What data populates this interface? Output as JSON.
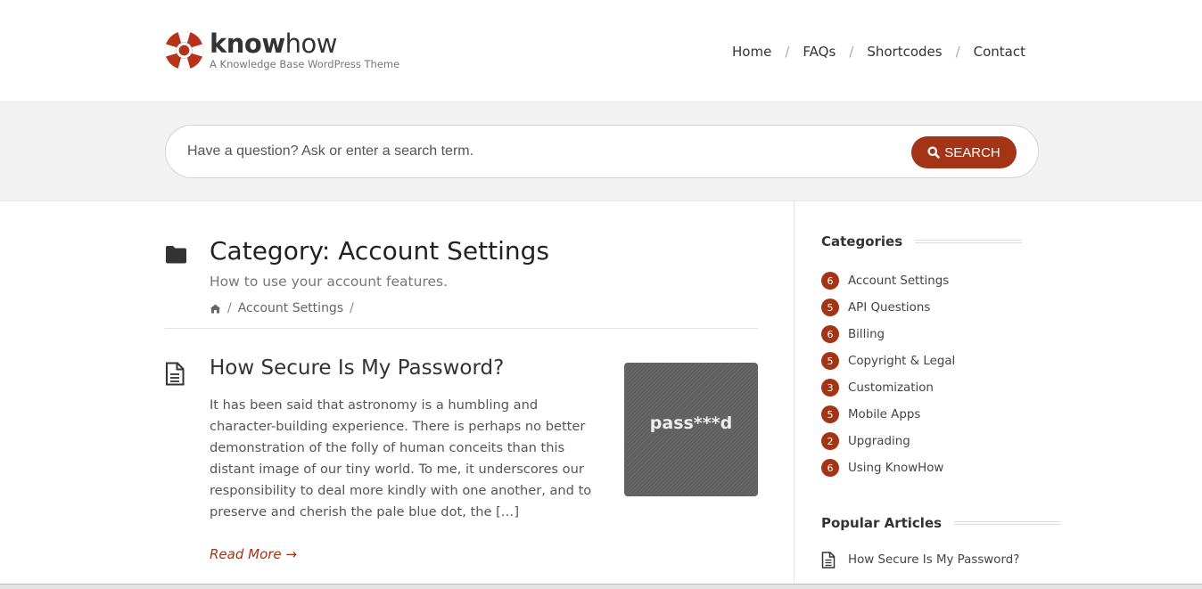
{
  "brand": {
    "name_bold": "know",
    "name_regular": "how",
    "tagline": "A Knowledge Base WordPress Theme",
    "logo_icon": "lifebuoy-icon",
    "accent_color": "#a33416"
  },
  "nav": {
    "items": [
      {
        "label": "Home"
      },
      {
        "label": "FAQs"
      },
      {
        "label": "Shortcodes"
      },
      {
        "label": "Contact"
      }
    ],
    "separator": "/"
  },
  "search": {
    "placeholder": "Have a question? Ask or enter a search term.",
    "button_label": "SEARCH",
    "button_icon": "search-icon"
  },
  "category": {
    "icon": "folder-icon",
    "title": "Category: Account Settings",
    "description": "How to use your account features.",
    "breadcrumb": {
      "home_icon": "home-icon",
      "current": "Account Settings",
      "separator": "/"
    }
  },
  "article": {
    "icon": "document-icon",
    "title": "How Secure Is My Password?",
    "excerpt": "It has been said that astronomy is a humbling and character-building experience. There is perhaps no better demonstration of the folly of human conceits than this distant image of our tiny world. To me, it underscores our responsibility to deal more kindly with one another, and to preserve and cherish the pale blue dot, the […]",
    "thumbnail_text": "pass***d",
    "read_more": "Read More →"
  },
  "sidebar": {
    "categories_heading": "Categories",
    "categories": [
      {
        "count": "6",
        "label": "Account Settings"
      },
      {
        "count": "5",
        "label": "API Questions"
      },
      {
        "count": "6",
        "label": "Billing"
      },
      {
        "count": "5",
        "label": "Copyright & Legal"
      },
      {
        "count": "3",
        "label": "Customization"
      },
      {
        "count": "5",
        "label": "Mobile Apps"
      },
      {
        "count": "2",
        "label": "Upgrading"
      },
      {
        "count": "6",
        "label": "Using KnowHow"
      }
    ],
    "popular_heading": "Popular Articles",
    "popular": [
      {
        "label": "How Secure Is My Password?",
        "icon": "document-icon"
      }
    ]
  }
}
